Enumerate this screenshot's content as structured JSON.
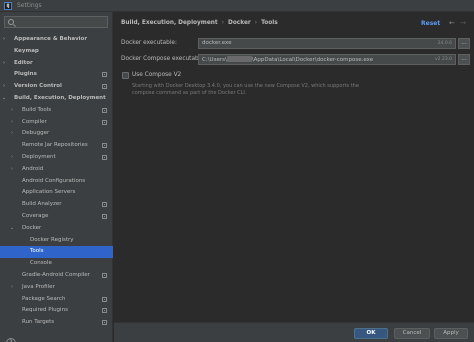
{
  "window": {
    "title": "Settings",
    "icon_text": "IJ"
  },
  "search": {
    "placeholder": ""
  },
  "tree": [
    {
      "label": "Appearance & Behavior",
      "bold": true,
      "chevron": "›",
      "indent": 0,
      "proj": false
    },
    {
      "label": "Keymap",
      "bold": true,
      "chevron": "",
      "indent": 0,
      "proj": false
    },
    {
      "label": "Editor",
      "bold": true,
      "chevron": "›",
      "indent": 0,
      "proj": false
    },
    {
      "label": "Plugins",
      "bold": true,
      "chevron": "",
      "indent": 0,
      "proj": true
    },
    {
      "label": "Version Control",
      "bold": true,
      "chevron": "›",
      "indent": 0,
      "proj": true
    },
    {
      "label": "Build, Execution, Deployment",
      "bold": true,
      "chevron": "⌄",
      "indent": 0,
      "proj": false
    },
    {
      "label": "Build Tools",
      "bold": false,
      "chevron": "›",
      "indent": 1,
      "proj": true
    },
    {
      "label": "Compiler",
      "bold": false,
      "chevron": "›",
      "indent": 1,
      "proj": true
    },
    {
      "label": "Debugger",
      "bold": false,
      "chevron": "›",
      "indent": 1,
      "proj": false
    },
    {
      "label": "Remote Jar Repositories",
      "bold": false,
      "chevron": "",
      "indent": 1,
      "proj": true
    },
    {
      "label": "Deployment",
      "bold": false,
      "chevron": "›",
      "indent": 1,
      "proj": true
    },
    {
      "label": "Android",
      "bold": false,
      "chevron": "›",
      "indent": 1,
      "proj": false
    },
    {
      "label": "Android Configurations",
      "bold": false,
      "chevron": "",
      "indent": 1,
      "proj": false
    },
    {
      "label": "Application Servers",
      "bold": false,
      "chevron": "",
      "indent": 1,
      "proj": false
    },
    {
      "label": "Build Analyzer",
      "bold": false,
      "chevron": "",
      "indent": 1,
      "proj": true
    },
    {
      "label": "Coverage",
      "bold": false,
      "chevron": "",
      "indent": 1,
      "proj": true
    },
    {
      "label": "Docker",
      "bold": false,
      "chevron": "⌄",
      "indent": 1,
      "proj": false
    },
    {
      "label": "Docker Registry",
      "bold": false,
      "chevron": "",
      "indent": 2,
      "proj": false
    },
    {
      "label": "Tools",
      "bold": false,
      "chevron": "",
      "indent": 2,
      "proj": false,
      "selected": true
    },
    {
      "label": "Console",
      "bold": false,
      "chevron": "",
      "indent": 2,
      "proj": false
    },
    {
      "label": "Gradle-Android Compiler",
      "bold": false,
      "chevron": "",
      "indent": 1,
      "proj": true
    },
    {
      "label": "Java Profiler",
      "bold": false,
      "chevron": "›",
      "indent": 1,
      "proj": false
    },
    {
      "label": "Package Search",
      "bold": false,
      "chevron": "",
      "indent": 1,
      "proj": true
    },
    {
      "label": "Required Plugins",
      "bold": false,
      "chevron": "",
      "indent": 1,
      "proj": true
    },
    {
      "label": "Run Targets",
      "bold": false,
      "chevron": "",
      "indent": 1,
      "proj": true
    }
  ],
  "breadcrumb": [
    "Build, Execution, Deployment",
    "Docker",
    "Tools"
  ],
  "reset_label": "Reset",
  "fields": {
    "docker_exe": {
      "label": "Docker executable:",
      "value": "docker.exe",
      "version": "24.0.6"
    },
    "compose_exe": {
      "label": "Docker Compose executable:",
      "value_prefix": "C:\\Users\\",
      "value_suffix": "\\AppData\\Local\\Docker\\docker-compose.exe",
      "version": "v2.23.0"
    },
    "browse_label": "..."
  },
  "use_compose_v2": {
    "label": "Use Compose V2",
    "checked": false,
    "hint": "Starting with Docker Desktop 3.4.0, you can use the new Compose V2, which supports the compose command as part of the Docker CLI."
  },
  "buttons": {
    "ok": "OK",
    "cancel": "Cancel",
    "apply": "Apply"
  },
  "help": "?"
}
